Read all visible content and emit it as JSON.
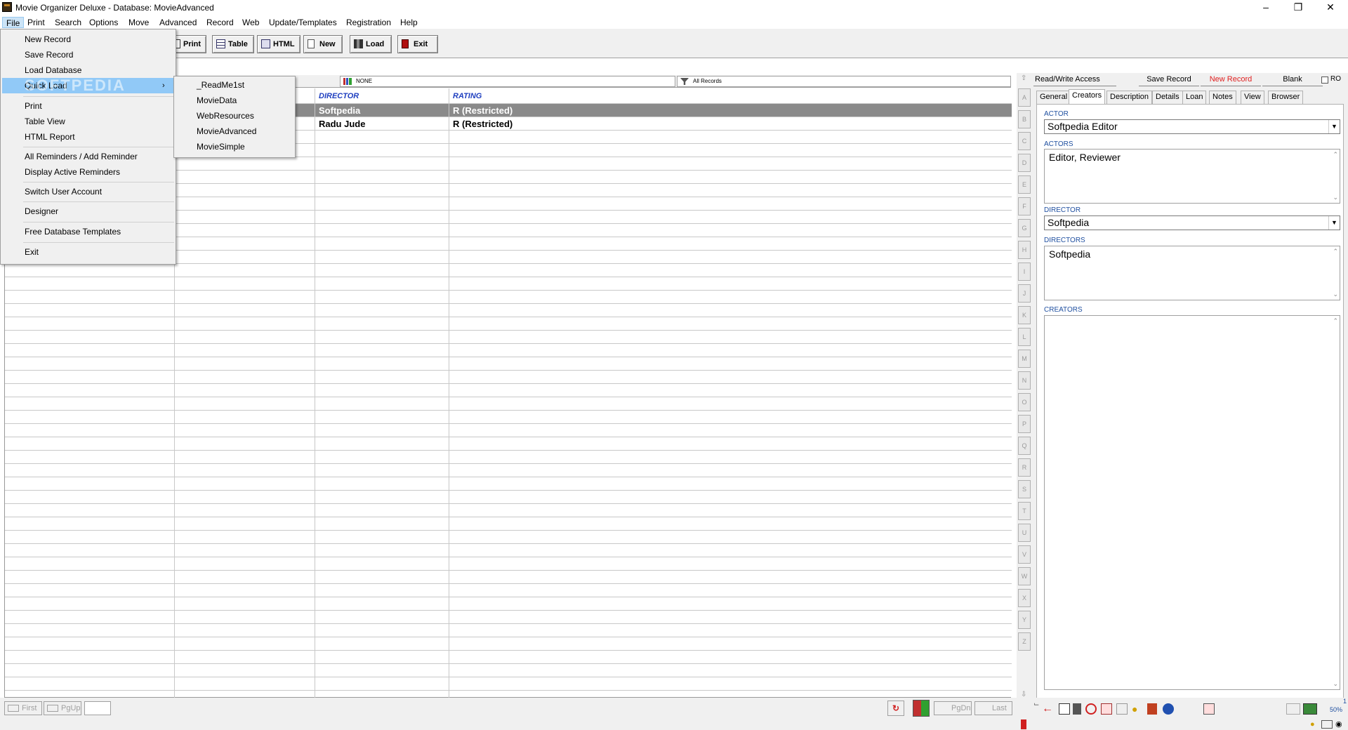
{
  "window": {
    "title": "Movie Organizer Deluxe - Database: MovieAdvanced"
  },
  "menubar": [
    "File",
    "Print",
    "Search",
    "Options",
    "Move",
    "Advanced",
    "Record",
    "Web",
    "Update/Templates",
    "Registration",
    "Help"
  ],
  "toolbar": {
    "print": "Print",
    "table": "Table",
    "html": "HTML",
    "new": "New",
    "load": "Load",
    "exit": "Exit"
  },
  "filter": {
    "sort": "NONE",
    "records": "All Records"
  },
  "grid": {
    "headers": {
      "director": "DIRECTOR",
      "rating": "RATING"
    },
    "rows": [
      {
        "director": "Softpedia",
        "rating": "R (Restricted)",
        "selected": true
      },
      {
        "director": "Radu Jude",
        "rating": "R (Restricted)",
        "selected": false
      }
    ]
  },
  "alphabet": [
    "A",
    "B",
    "C",
    "D",
    "E",
    "F",
    "G",
    "H",
    "I",
    "J",
    "K",
    "L",
    "M",
    "N",
    "O",
    "P",
    "Q",
    "R",
    "S",
    "T",
    "U",
    "V",
    "W",
    "X",
    "Y",
    "Z"
  ],
  "right_panel": {
    "access": "Read/Write Access",
    "save_record": "Save Record",
    "new_record": "New Record",
    "blank": "Blank",
    "ro": "RO",
    "tabs": [
      "General",
      "Creators",
      "Description",
      "Details",
      "Loan",
      "Notes",
      "View",
      "Browser"
    ],
    "selected_tab": "Creators",
    "actor_label": "ACTOR",
    "actor_value": "Softpedia Editor",
    "actors_label": "ACTORS",
    "actors_value": "Editor, Reviewer",
    "director_label": "DIRECTOR",
    "director_value": "Softpedia",
    "directors_label": "DIRECTORS",
    "directors_value": "Softpedia",
    "creators_label": "CREATORS",
    "creators_value": ""
  },
  "navbar": {
    "first": "First",
    "pgup": "PgUp",
    "pgdn": "PgDn",
    "last": "Last"
  },
  "zoom": "50%",
  "zoom_top": "1",
  "file_menu": {
    "items": [
      "New Record",
      "Save Record",
      "Load Database",
      "Quick Load",
      "Print",
      "Table View",
      "HTML Report",
      "All Reminders / Add Reminder",
      "Display Active Reminders",
      "Switch User Account",
      "Designer",
      "Free Database Templates",
      "Exit"
    ],
    "watermark": "SOFTPEDIA"
  },
  "quick_load": [
    "_ReadMe1st",
    "MovieData",
    "WebResources",
    "MovieAdvanced",
    "MovieSimple"
  ],
  "colors": {
    "highlight": "#91c9f7",
    "header_text": "#2040c0",
    "selected_row": "#8a8a8a",
    "new_record": "#e02020"
  }
}
